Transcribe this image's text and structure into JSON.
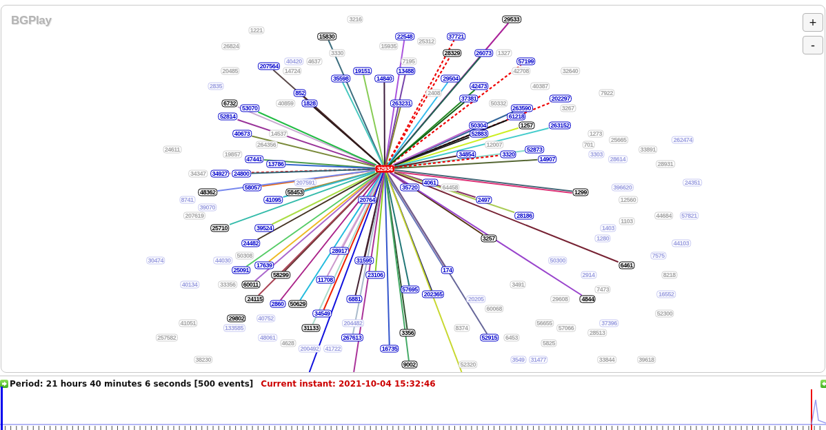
{
  "graph": {
    "logo": "BGPlay",
    "zoom_buttons": [
      "+",
      "-"
    ],
    "nodes": [
      {
        "label": "3216",
        "kind": "faded"
      },
      {
        "label": "29533",
        "kind": "peer",
        "links": [
          {
            "kind": "active"
          }
        ]
      },
      {
        "label": "1221",
        "kind": "faded"
      },
      {
        "label": "15830",
        "kind": "peer",
        "links": [
          {
            "kind": "active"
          }
        ]
      },
      {
        "label": "22548",
        "kind": "transit",
        "links": [
          {
            "kind": "active"
          }
        ]
      },
      {
        "label": "37721",
        "kind": "transit",
        "links": [
          {
            "kind": "withdrawn"
          }
        ]
      },
      {
        "label": "25312",
        "kind": "faded"
      },
      {
        "label": "26824",
        "kind": "faded"
      },
      {
        "label": "15935",
        "kind": "faded"
      },
      {
        "label": "3330",
        "kind": "faded"
      },
      {
        "label": "28329",
        "kind": "peer",
        "links": [
          {
            "kind": "withdrawn"
          }
        ]
      },
      {
        "label": "26073",
        "kind": "transit",
        "links": [
          {
            "kind": "active"
          }
        ]
      },
      {
        "label": "1327",
        "kind": "faded"
      },
      {
        "label": "40420",
        "kind": "faded-transit"
      },
      {
        "label": "4637",
        "kind": "faded"
      },
      {
        "label": "7195",
        "kind": "faded"
      },
      {
        "label": "57199",
        "kind": "transit",
        "links": [
          {
            "kind": "withdrawn"
          }
        ]
      },
      {
        "label": "207564",
        "kind": "transit",
        "links": [
          {
            "kind": "active"
          }
        ]
      },
      {
        "label": "20485",
        "kind": "faded"
      },
      {
        "label": "14724",
        "kind": "faded"
      },
      {
        "label": "19151",
        "kind": "transit",
        "links": [
          {
            "kind": "active"
          }
        ]
      },
      {
        "label": "13488",
        "kind": "transit",
        "links": [
          {
            "kind": "active"
          }
        ]
      },
      {
        "label": "42708",
        "kind": "faded"
      },
      {
        "label": "32640",
        "kind": "faded"
      },
      {
        "label": "35598",
        "kind": "transit",
        "links": [
          {
            "kind": "active"
          }
        ]
      },
      {
        "label": "14840",
        "kind": "transit",
        "links": [
          {
            "kind": "active"
          }
        ]
      },
      {
        "label": "29504",
        "kind": "transit",
        "links": [
          {
            "kind": "active"
          }
        ]
      },
      {
        "label": "2835",
        "kind": "faded-transit"
      },
      {
        "label": "42473",
        "kind": "transit",
        "links": [
          {
            "kind": "active"
          }
        ]
      },
      {
        "label": "40387",
        "kind": "faded"
      },
      {
        "label": "852",
        "kind": "transit",
        "links": [
          {
            "kind": "active"
          }
        ]
      },
      {
        "label": "2408",
        "kind": "faded"
      },
      {
        "label": "7922",
        "kind": "faded"
      },
      {
        "label": "37381",
        "kind": "transit",
        "links": [
          {
            "kind": "active"
          }
        ]
      },
      {
        "label": "202297",
        "kind": "transit",
        "links": [
          {
            "kind": "withdrawn"
          }
        ]
      },
      {
        "label": "6732",
        "kind": "peer",
        "links": [
          {
            "kind": "active"
          }
        ]
      },
      {
        "label": "40859",
        "kind": "faded"
      },
      {
        "label": "1828",
        "kind": "transit",
        "links": [
          {
            "kind": "active"
          }
        ]
      },
      {
        "label": "263231",
        "kind": "transit",
        "links": [
          {
            "kind": "active"
          }
        ]
      },
      {
        "label": "50332",
        "kind": "faded"
      },
      {
        "label": "53070",
        "kind": "transit",
        "links": [
          {
            "kind": "active"
          }
        ]
      },
      {
        "label": "263590",
        "kind": "transit",
        "links": [
          {
            "kind": "active"
          }
        ]
      },
      {
        "label": "3267",
        "kind": "faded"
      },
      {
        "label": "52814",
        "kind": "transit",
        "links": [
          {
            "kind": "active"
          }
        ]
      },
      {
        "label": "61218",
        "kind": "transit",
        "links": [
          {
            "kind": "active"
          }
        ]
      },
      {
        "label": "50304",
        "kind": "transit",
        "links": [
          {
            "kind": "active"
          }
        ]
      },
      {
        "label": "1257",
        "kind": "peer",
        "links": [
          {
            "kind": "active"
          }
        ]
      },
      {
        "label": "263152",
        "kind": "transit",
        "links": [
          {
            "kind": "active"
          }
        ]
      },
      {
        "label": "40673",
        "kind": "transit",
        "links": [
          {
            "kind": "active"
          }
        ]
      },
      {
        "label": "14537",
        "kind": "faded"
      },
      {
        "label": "52883",
        "kind": "transit",
        "links": [
          {
            "kind": "active"
          }
        ]
      },
      {
        "label": "1273",
        "kind": "faded"
      },
      {
        "label": "25665",
        "kind": "faded"
      },
      {
        "label": "262474",
        "kind": "faded-transit"
      },
      {
        "label": "264356",
        "kind": "faded"
      },
      {
        "label": "12007",
        "kind": "faded"
      },
      {
        "label": "701",
        "kind": "faded"
      },
      {
        "label": "24611",
        "kind": "faded"
      },
      {
        "label": "52873",
        "kind": "transit",
        "links": [
          {
            "kind": "active"
          }
        ]
      },
      {
        "label": "33891",
        "kind": "faded"
      },
      {
        "label": "19857",
        "kind": "faded"
      },
      {
        "label": "34854",
        "kind": "transit",
        "links": [
          {
            "kind": "active"
          }
        ]
      },
      {
        "label": "3320",
        "kind": "transit",
        "links": [
          {
            "kind": "withdrawn"
          }
        ]
      },
      {
        "label": "3303",
        "kind": "faded-transit"
      },
      {
        "label": "47441",
        "kind": "transit",
        "links": [
          {
            "kind": "active"
          }
        ]
      },
      {
        "label": "14907",
        "kind": "transit",
        "links": [
          {
            "kind": "active"
          }
        ]
      },
      {
        "label": "28614",
        "kind": "faded-transit"
      },
      {
        "label": "13786",
        "kind": "transit",
        "links": [
          {
            "kind": "active"
          }
        ]
      },
      {
        "label": "28931",
        "kind": "faded"
      },
      {
        "label": "32934",
        "kind": "origin"
      },
      {
        "label": "34347",
        "kind": "faded"
      },
      {
        "label": "34927",
        "kind": "transit",
        "links": [
          {
            "kind": "withdrawn"
          }
        ]
      },
      {
        "label": "24800",
        "kind": "transit",
        "links": [
          {
            "kind": "active"
          }
        ]
      },
      {
        "label": "207591",
        "kind": "faded-transit"
      },
      {
        "label": "4061",
        "kind": "transit",
        "links": [
          {
            "kind": "active"
          }
        ]
      },
      {
        "label": "24351",
        "kind": "faded-transit"
      },
      {
        "label": "58057",
        "kind": "transit",
        "links": [
          {
            "kind": "active"
          }
        ]
      },
      {
        "label": "35720",
        "kind": "transit",
        "links": [
          {
            "kind": "active"
          }
        ]
      },
      {
        "label": "64458",
        "kind": "faded"
      },
      {
        "label": "396620",
        "kind": "faded-transit"
      },
      {
        "label": "48362",
        "kind": "peer",
        "links": [
          {
            "kind": "active"
          }
        ]
      },
      {
        "label": "58453",
        "kind": "peer",
        "links": [
          {
            "kind": "active"
          }
        ]
      },
      {
        "label": "1299",
        "kind": "peer",
        "links": [
          {
            "kind": "active"
          },
          {
            "kind": "active"
          }
        ]
      },
      {
        "label": "8741",
        "kind": "faded-transit"
      },
      {
        "label": "41095",
        "kind": "transit",
        "links": [
          {
            "kind": "active"
          }
        ]
      },
      {
        "label": "20764",
        "kind": "transit",
        "links": [
          {
            "kind": "active"
          }
        ]
      },
      {
        "label": "2497",
        "kind": "transit",
        "links": [
          {
            "kind": "active"
          }
        ]
      },
      {
        "label": "12560",
        "kind": "faded"
      },
      {
        "label": "39070",
        "kind": "faded-transit"
      },
      {
        "label": "207619",
        "kind": "faded"
      },
      {
        "label": "28186",
        "kind": "transit",
        "links": [
          {
            "kind": "active"
          }
        ]
      },
      {
        "label": "44684",
        "kind": "faded"
      },
      {
        "label": "57821",
        "kind": "faded-transit"
      },
      {
        "label": "1103",
        "kind": "faded"
      },
      {
        "label": "25710",
        "kind": "peer",
        "links": [
          {
            "kind": "active"
          }
        ]
      },
      {
        "label": "39524",
        "kind": "transit",
        "links": [
          {
            "kind": "active"
          }
        ]
      },
      {
        "label": "1403",
        "kind": "faded-transit"
      },
      {
        "label": "3257",
        "kind": "peer",
        "links": [
          {
            "kind": "active"
          }
        ]
      },
      {
        "label": "1280",
        "kind": "faded-transit"
      },
      {
        "label": "24482",
        "kind": "transit",
        "links": [
          {
            "kind": "active"
          }
        ]
      },
      {
        "label": "44103",
        "kind": "faded-transit"
      },
      {
        "label": "28917",
        "kind": "transit",
        "links": [
          {
            "kind": "active"
          }
        ]
      },
      {
        "label": "50308",
        "kind": "faded"
      },
      {
        "label": "7575",
        "kind": "faded-transit"
      },
      {
        "label": "30474",
        "kind": "faded-transit"
      },
      {
        "label": "44030",
        "kind": "faded-transit"
      },
      {
        "label": "31595",
        "kind": "transit",
        "links": [
          {
            "kind": "active"
          }
        ]
      },
      {
        "label": "50300",
        "kind": "faded-transit"
      },
      {
        "label": "17639",
        "kind": "transit",
        "links": [
          {
            "kind": "active"
          }
        ]
      },
      {
        "label": "6461",
        "kind": "peer",
        "links": [
          {
            "kind": "active"
          }
        ]
      },
      {
        "label": "25091",
        "kind": "transit",
        "links": [
          {
            "kind": "active"
          }
        ]
      },
      {
        "label": "174",
        "kind": "transit",
        "links": [
          {
            "kind": "active"
          },
          {
            "kind": "active"
          }
        ]
      },
      {
        "label": "58299",
        "kind": "peer",
        "links": [
          {
            "kind": "active"
          }
        ]
      },
      {
        "label": "23106",
        "kind": "transit",
        "links": [
          {
            "kind": "active"
          }
        ]
      },
      {
        "label": "2914",
        "kind": "faded-transit"
      },
      {
        "label": "8218",
        "kind": "faded"
      },
      {
        "label": "11708",
        "kind": "transit",
        "links": [
          {
            "kind": "active"
          }
        ]
      },
      {
        "label": "40134",
        "kind": "faded-transit"
      },
      {
        "label": "33356",
        "kind": "faded"
      },
      {
        "label": "60011",
        "kind": "peer",
        "links": [
          {
            "kind": "active"
          }
        ]
      },
      {
        "label": "3491",
        "kind": "faded"
      },
      {
        "label": "57695",
        "kind": "transit",
        "links": [
          {
            "kind": "active"
          }
        ]
      },
      {
        "label": "7473",
        "kind": "faded"
      },
      {
        "label": "202365",
        "kind": "transit",
        "links": [
          {
            "kind": "active"
          }
        ]
      },
      {
        "label": "16552",
        "kind": "faded-transit"
      },
      {
        "label": "24115",
        "kind": "peer",
        "links": [
          {
            "kind": "active"
          }
        ]
      },
      {
        "label": "6881",
        "kind": "transit",
        "links": [
          {
            "kind": "active"
          }
        ]
      },
      {
        "label": "20205",
        "kind": "faded-transit"
      },
      {
        "label": "29608",
        "kind": "faded"
      },
      {
        "label": "4844",
        "kind": "peer",
        "links": [
          {
            "kind": "active"
          }
        ]
      },
      {
        "label": "2860",
        "kind": "transit",
        "links": [
          {
            "kind": "active"
          }
        ]
      },
      {
        "label": "50629",
        "kind": "peer",
        "links": [
          {
            "kind": "active"
          }
        ]
      },
      {
        "label": "60068",
        "kind": "faded"
      },
      {
        "label": "34549",
        "kind": "transit",
        "links": [
          {
            "kind": "active"
          }
        ]
      },
      {
        "label": "52300",
        "kind": "faded"
      },
      {
        "label": "29802",
        "kind": "peer"
      },
      {
        "label": "40752",
        "kind": "faded-transit"
      },
      {
        "label": "41051",
        "kind": "faded"
      },
      {
        "label": "204482",
        "kind": "faded-transit"
      },
      {
        "label": "56655",
        "kind": "faded"
      },
      {
        "label": "37396",
        "kind": "faded-transit"
      },
      {
        "label": "133585",
        "kind": "faded-transit"
      },
      {
        "label": "31133",
        "kind": "peer",
        "links": [
          {
            "kind": "active"
          }
        ]
      },
      {
        "label": "8374",
        "kind": "faded"
      },
      {
        "label": "57066",
        "kind": "faded"
      },
      {
        "label": "3356",
        "kind": "peer",
        "links": [
          {
            "kind": "active"
          }
        ]
      },
      {
        "label": "28513",
        "kind": "faded"
      },
      {
        "label": "257582",
        "kind": "faded"
      },
      {
        "label": "48061",
        "kind": "faded-transit"
      },
      {
        "label": "267613",
        "kind": "transit",
        "links": [
          {
            "kind": "active"
          }
        ]
      },
      {
        "label": "52915",
        "kind": "transit",
        "links": [
          {
            "kind": "active"
          }
        ]
      },
      {
        "label": "6453",
        "kind": "faded"
      },
      {
        "label": "4628",
        "kind": "faded"
      },
      {
        "label": "5825",
        "kind": "faded"
      },
      {
        "label": "200492",
        "kind": "faded-transit"
      },
      {
        "label": "41722",
        "kind": "faded-transit"
      },
      {
        "label": "16735",
        "kind": "transit",
        "links": [
          {
            "kind": "active"
          }
        ]
      },
      {
        "label": "38230",
        "kind": "faded"
      },
      {
        "label": "3549",
        "kind": "faded-transit"
      },
      {
        "label": "31477",
        "kind": "faded-transit"
      },
      {
        "label": "33844",
        "kind": "faded"
      },
      {
        "label": "39618",
        "kind": "faded"
      },
      {
        "label": "9002",
        "kind": "peer",
        "links": [
          {
            "kind": "active"
          }
        ]
      },
      {
        "label": "52320",
        "kind": "faded"
      }
    ],
    "offscreen_links": [
      {
        "kind": "active"
      },
      {
        "kind": "active"
      },
      {
        "kind": "active"
      }
    ]
  },
  "timeline": {
    "period": "Period: 21 hours 40 minutes 6 seconds [500 events]",
    "current_instant": "Current instant: 2021-10-04 15:32:46",
    "level": 0.982
  }
}
